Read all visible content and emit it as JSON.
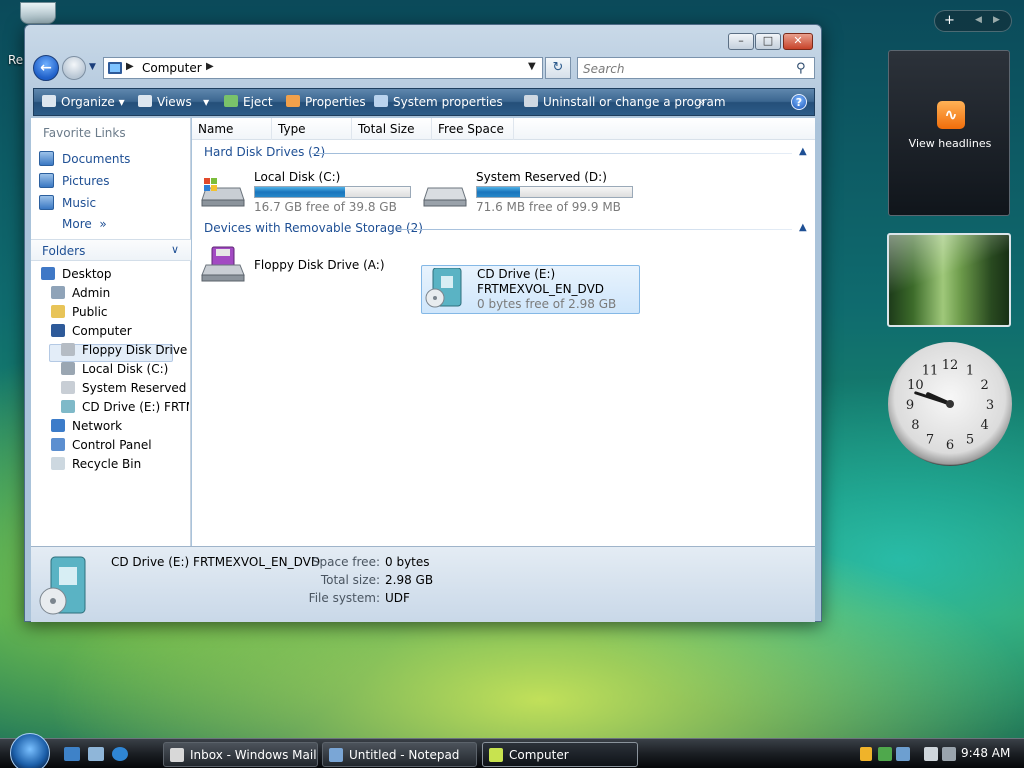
{
  "desktop": {
    "icon_label": "Re"
  },
  "window": {
    "address": {
      "location": "Computer"
    },
    "search": {
      "placeholder": "Search"
    },
    "toolbar": {
      "organize": "Organize",
      "views": "Views",
      "eject": "Eject",
      "properties": "Properties",
      "system_properties": "System properties",
      "uninstall": "Uninstall or change a program",
      "more": "»",
      "help": "?"
    },
    "nav": {
      "favorite_links_title": "Favorite Links",
      "favorites": [
        "Documents",
        "Pictures",
        "Music",
        "More"
      ],
      "folders_title": "Folders",
      "tree": [
        "Desktop",
        "Admin",
        "Public",
        "Computer",
        "Floppy Disk Drive (A:)",
        "Local Disk (C:)",
        "System Reserved (D:)",
        "CD Drive (E:) FRTMEXVOL_EN_DVD",
        "Network",
        "Control Panel",
        "Recycle Bin"
      ]
    },
    "columns": [
      "Name",
      "Type",
      "Total Size",
      "Free Space"
    ],
    "groups": {
      "hard_disks": "Hard Disk Drives (2)",
      "removable": "Devices with Removable Storage (2)"
    },
    "drives": {
      "c": {
        "name": "Local Disk (C:)",
        "free_text": "16.7 GB free of 39.8 GB",
        "used_fraction": 0.58
      },
      "d": {
        "name": "System Reserved (D:)",
        "free_text": "71.6 MB free of 99.9 MB",
        "used_fraction": 0.28
      },
      "a": {
        "name": "Floppy Disk Drive (A:)"
      },
      "e": {
        "name": "CD Drive (E:)",
        "label": "FRTMEXVOL_EN_DVD",
        "free_text": "0 bytes free of 2.98 GB"
      }
    },
    "details": {
      "title": "CD Drive (E:) FRTMEXVOL_EN_DVD",
      "space_free_key": "Space free:",
      "space_free_val": "0 bytes",
      "total_size_key": "Total size:",
      "total_size_val": "2.98 GB",
      "file_system_key": "File system:",
      "file_system_val": "UDF"
    }
  },
  "gadgets": {
    "feed_label": "View headlines",
    "clock_numbers": [
      "12",
      "1",
      "2",
      "3",
      "4",
      "5",
      "6",
      "7",
      "8",
      "9",
      "10",
      "11"
    ],
    "clock_time": "9:48"
  },
  "taskbar": {
    "tasks": [
      "Inbox - Windows Mail",
      "Untitled - Notepad",
      "Computer"
    ],
    "time": "9:48 AM"
  },
  "colors": {
    "accent": "#1e4f94",
    "progress": "#1a75bd",
    "toolbar": "#2d5c88"
  }
}
